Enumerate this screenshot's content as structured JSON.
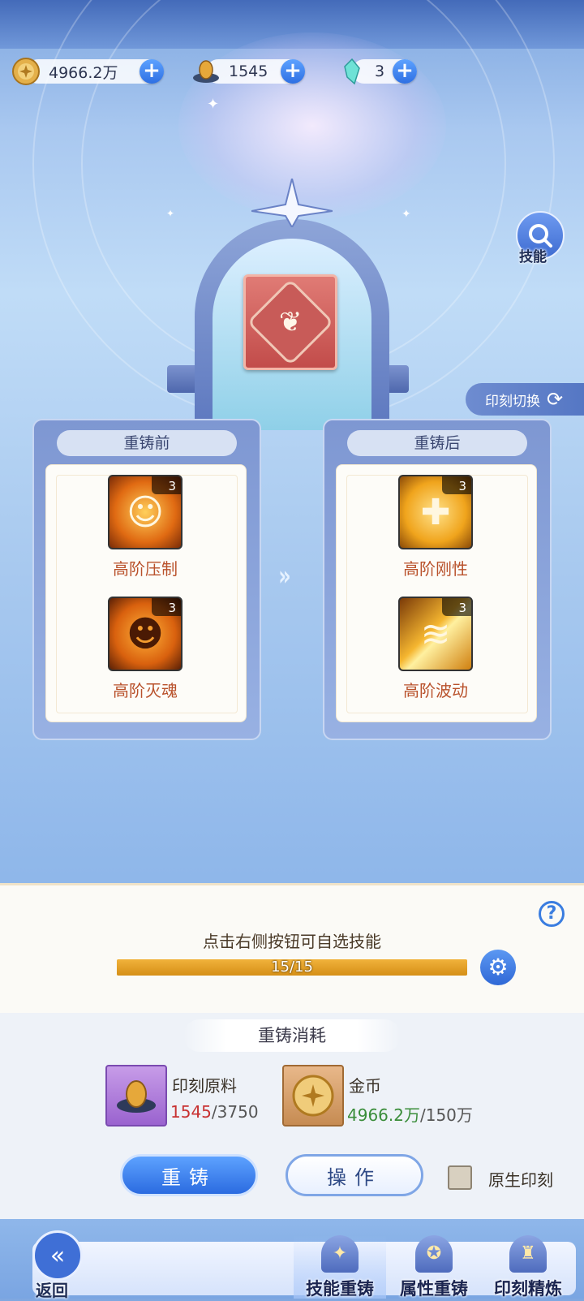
{
  "currencies": [
    {
      "name": "gold-coin",
      "value": "4966.2万"
    },
    {
      "name": "imprint-material",
      "value": "1545"
    },
    {
      "name": "crystal",
      "value": "3"
    }
  ],
  "side": {
    "skill_label": "技能",
    "switch_label": "印刻切换"
  },
  "before": {
    "title": "重铸前",
    "skills": [
      {
        "level": "3",
        "name": "高阶压制",
        "icon": "flame-figure-icon"
      },
      {
        "level": "3",
        "name": "高阶灭魂",
        "icon": "pumpkin-face-icon"
      }
    ]
  },
  "after": {
    "title": "重铸后",
    "skills": [
      {
        "level": "3",
        "name": "高阶刚性",
        "icon": "heart-cross-icon"
      },
      {
        "level": "3",
        "name": "高阶波动",
        "icon": "energy-wave-icon"
      }
    ]
  },
  "progress": {
    "hint": "点击右侧按钮可自选技能",
    "text": "15/15",
    "current": 15,
    "max": 15
  },
  "cost": {
    "title": "重铸消耗",
    "items": [
      {
        "label": "印刻原料",
        "have": "1545",
        "need": "/3750"
      },
      {
        "label": "金币",
        "have": "4966.2万",
        "need": "/150万"
      }
    ]
  },
  "actions": {
    "recast": "重铸",
    "operate": "操作",
    "native_label": "原生印刻"
  },
  "nav": {
    "back": "返回",
    "tabs": [
      "技能重铸",
      "属性重铸",
      "印刻精炼"
    ]
  },
  "colors": {
    "accent": "#3a7de0",
    "progress": "#e3a22a",
    "skill_name": "#b9522c"
  }
}
